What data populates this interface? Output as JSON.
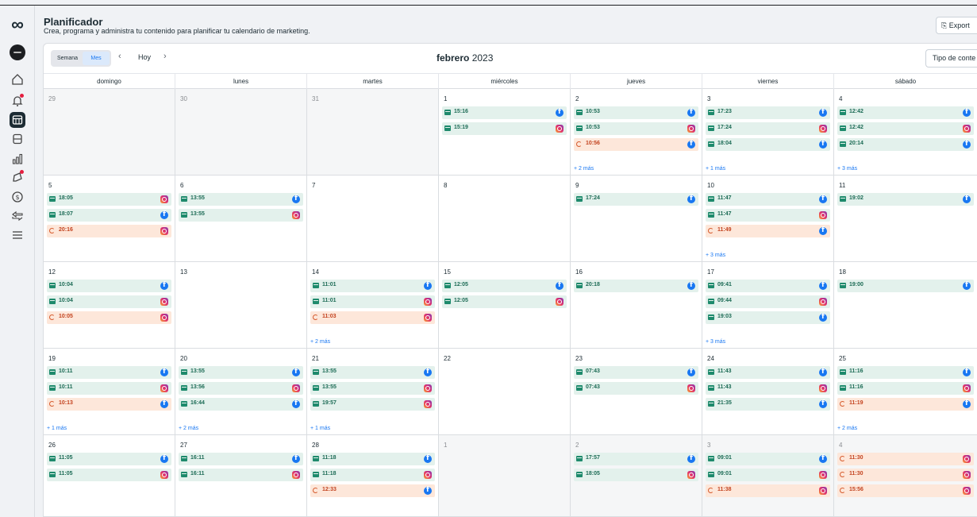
{
  "app": {
    "title": "Planificador",
    "subtitle": "Crea, programa y administra tu contenido para planificar tu calendario de marketing.",
    "export_label": "Export",
    "type_filter_label": "Tipo de conte"
  },
  "sidebar": {
    "logo": "∞",
    "items": [
      {
        "name": "home-icon",
        "active": false
      },
      {
        "name": "notifications-icon",
        "active": false,
        "badge": true
      },
      {
        "name": "planner-icon",
        "active": true
      },
      {
        "name": "content-icon",
        "active": false
      },
      {
        "name": "insights-icon",
        "active": false
      },
      {
        "name": "ads-icon",
        "active": false,
        "badge": true
      },
      {
        "name": "monetization-icon",
        "active": false
      },
      {
        "name": "inbox-icon",
        "active": false
      },
      {
        "name": "menu-icon",
        "active": false
      }
    ]
  },
  "toolbar": {
    "view_week": "Semana",
    "view_month": "Mes",
    "prev": "‹",
    "today": "Hoy",
    "next": "›",
    "month": "febrero",
    "year": "2023"
  },
  "weekdays": [
    "domingo",
    "lunes",
    "martes",
    "miércoles",
    "jueves",
    "viernes",
    "sábado"
  ],
  "weeks": [
    [
      {
        "day": "29",
        "muted": true,
        "events": []
      },
      {
        "day": "30",
        "muted": true,
        "events": []
      },
      {
        "day": "31",
        "muted": true,
        "events": []
      },
      {
        "day": "1",
        "events": [
          {
            "time": "15:16",
            "type": "sched",
            "platform": "fb"
          },
          {
            "time": "15:19",
            "type": "sched",
            "platform": "ig"
          }
        ]
      },
      {
        "day": "2",
        "events": [
          {
            "time": "10:53",
            "type": "sched",
            "platform": "fb"
          },
          {
            "time": "10:53",
            "type": "sched",
            "platform": "ig"
          },
          {
            "time": "10:56",
            "type": "draft",
            "platform": "fb"
          }
        ],
        "more": "+ 2 más"
      },
      {
        "day": "3",
        "events": [
          {
            "time": "17:23",
            "type": "sched",
            "platform": "fb"
          },
          {
            "time": "17:24",
            "type": "sched",
            "platform": "ig"
          },
          {
            "time": "18:04",
            "type": "sched",
            "platform": "fb"
          }
        ],
        "more": "+ 1 más"
      },
      {
        "day": "4",
        "events": [
          {
            "time": "12:42",
            "type": "sched",
            "platform": "fb"
          },
          {
            "time": "12:42",
            "type": "sched",
            "platform": "ig"
          },
          {
            "time": "20:14",
            "type": "sched",
            "platform": "fb"
          }
        ],
        "more": "+ 3 más"
      }
    ],
    [
      {
        "day": "5",
        "events": [
          {
            "time": "18:05",
            "type": "sched",
            "platform": "ig"
          },
          {
            "time": "18:07",
            "type": "sched",
            "platform": "fb"
          },
          {
            "time": "20:16",
            "type": "draft",
            "platform": "ig"
          }
        ]
      },
      {
        "day": "6",
        "events": [
          {
            "time": "13:55",
            "type": "sched",
            "platform": "fb"
          },
          {
            "time": "13:55",
            "type": "sched",
            "platform": "ig"
          }
        ]
      },
      {
        "day": "7",
        "events": []
      },
      {
        "day": "8",
        "events": []
      },
      {
        "day": "9",
        "events": [
          {
            "time": "17:24",
            "type": "sched",
            "platform": "fb"
          }
        ]
      },
      {
        "day": "10",
        "events": [
          {
            "time": "11:47",
            "type": "sched",
            "platform": "fb"
          },
          {
            "time": "11:47",
            "type": "sched",
            "platform": "ig"
          },
          {
            "time": "11:49",
            "type": "draft",
            "platform": "fb"
          }
        ],
        "more": "+ 3 más"
      },
      {
        "day": "11",
        "events": [
          {
            "time": "19:02",
            "type": "sched",
            "platform": "fb"
          }
        ]
      }
    ],
    [
      {
        "day": "12",
        "events": [
          {
            "time": "10:04",
            "type": "sched",
            "platform": "fb"
          },
          {
            "time": "10:04",
            "type": "sched",
            "platform": "ig"
          },
          {
            "time": "10:05",
            "type": "draft",
            "platform": "ig"
          }
        ]
      },
      {
        "day": "13",
        "events": []
      },
      {
        "day": "14",
        "events": [
          {
            "time": "11:01",
            "type": "sched",
            "platform": "fb"
          },
          {
            "time": "11:01",
            "type": "sched",
            "platform": "ig"
          },
          {
            "time": "11:03",
            "type": "draft",
            "platform": "ig"
          }
        ],
        "more": "+ 2 más"
      },
      {
        "day": "15",
        "events": [
          {
            "time": "12:05",
            "type": "sched",
            "platform": "fb"
          },
          {
            "time": "12:05",
            "type": "sched",
            "platform": "ig"
          }
        ]
      },
      {
        "day": "16",
        "events": [
          {
            "time": "20:18",
            "type": "sched",
            "platform": "fb"
          }
        ]
      },
      {
        "day": "17",
        "events": [
          {
            "time": "09:41",
            "type": "sched",
            "platform": "fb"
          },
          {
            "time": "09:44",
            "type": "sched",
            "platform": "ig"
          },
          {
            "time": "19:03",
            "type": "sched",
            "platform": "fb"
          }
        ],
        "more": "+ 3 más"
      },
      {
        "day": "18",
        "events": [
          {
            "time": "19:00",
            "type": "sched",
            "platform": "fb"
          }
        ]
      }
    ],
    [
      {
        "day": "19",
        "events": [
          {
            "time": "10:11",
            "type": "sched",
            "platform": "fb"
          },
          {
            "time": "10:11",
            "type": "sched",
            "platform": "ig"
          },
          {
            "time": "10:13",
            "type": "draft",
            "platform": "fb"
          }
        ],
        "more": "+ 1 más"
      },
      {
        "day": "20",
        "events": [
          {
            "time": "13:55",
            "type": "sched",
            "platform": "fb"
          },
          {
            "time": "13:56",
            "type": "sched",
            "platform": "ig"
          },
          {
            "time": "16:44",
            "type": "sched",
            "platform": "fb"
          }
        ],
        "more": "+ 2 más"
      },
      {
        "day": "21",
        "events": [
          {
            "time": "13:55",
            "type": "sched",
            "platform": "fb"
          },
          {
            "time": "13:55",
            "type": "sched",
            "platform": "ig"
          },
          {
            "time": "19:57",
            "type": "sched",
            "platform": "ig"
          }
        ],
        "more": "+ 1 más"
      },
      {
        "day": "22",
        "events": []
      },
      {
        "day": "23",
        "events": [
          {
            "time": "07:43",
            "type": "sched",
            "platform": "fb"
          },
          {
            "time": "07:43",
            "type": "sched",
            "platform": "ig"
          }
        ]
      },
      {
        "day": "24",
        "events": [
          {
            "time": "11:43",
            "type": "sched",
            "platform": "fb"
          },
          {
            "time": "11:43",
            "type": "sched",
            "platform": "ig"
          },
          {
            "time": "21:35",
            "type": "sched",
            "platform": "fb"
          }
        ]
      },
      {
        "day": "25",
        "events": [
          {
            "time": "11:16",
            "type": "sched",
            "platform": "fb"
          },
          {
            "time": "11:16",
            "type": "sched",
            "platform": "ig"
          },
          {
            "time": "11:19",
            "type": "draft",
            "platform": "fb"
          }
        ],
        "more": "+ 2 más"
      }
    ],
    [
      {
        "day": "26",
        "events": [
          {
            "time": "11:05",
            "type": "sched",
            "platform": "fb"
          },
          {
            "time": "11:05",
            "type": "sched",
            "platform": "ig"
          }
        ]
      },
      {
        "day": "27",
        "events": [
          {
            "time": "16:11",
            "type": "sched",
            "platform": "fb"
          },
          {
            "time": "16:11",
            "type": "sched",
            "platform": "ig"
          }
        ]
      },
      {
        "day": "28",
        "events": [
          {
            "time": "11:18",
            "type": "sched",
            "platform": "fb"
          },
          {
            "time": "11:18",
            "type": "sched",
            "platform": "ig"
          },
          {
            "time": "12:33",
            "type": "draft",
            "platform": "fb"
          }
        ]
      },
      {
        "day": "1",
        "muted": true,
        "events": []
      },
      {
        "day": "2",
        "muted": true,
        "events": [
          {
            "time": "17:57",
            "type": "sched",
            "platform": "fb"
          },
          {
            "time": "18:05",
            "type": "sched",
            "platform": "ig"
          }
        ]
      },
      {
        "day": "3",
        "muted": true,
        "events": [
          {
            "time": "09:01",
            "type": "sched",
            "platform": "fb"
          },
          {
            "time": "09:01",
            "type": "sched",
            "platform": "ig"
          },
          {
            "time": "11:38",
            "type": "draft",
            "platform": "ig"
          }
        ]
      },
      {
        "day": "4",
        "muted": true,
        "events": [
          {
            "time": "11:30",
            "type": "draft",
            "platform": "ig"
          },
          {
            "time": "11:30",
            "type": "draft",
            "platform": "ig"
          },
          {
            "time": "15:56",
            "type": "draft",
            "platform": "ig"
          }
        ]
      }
    ]
  ]
}
